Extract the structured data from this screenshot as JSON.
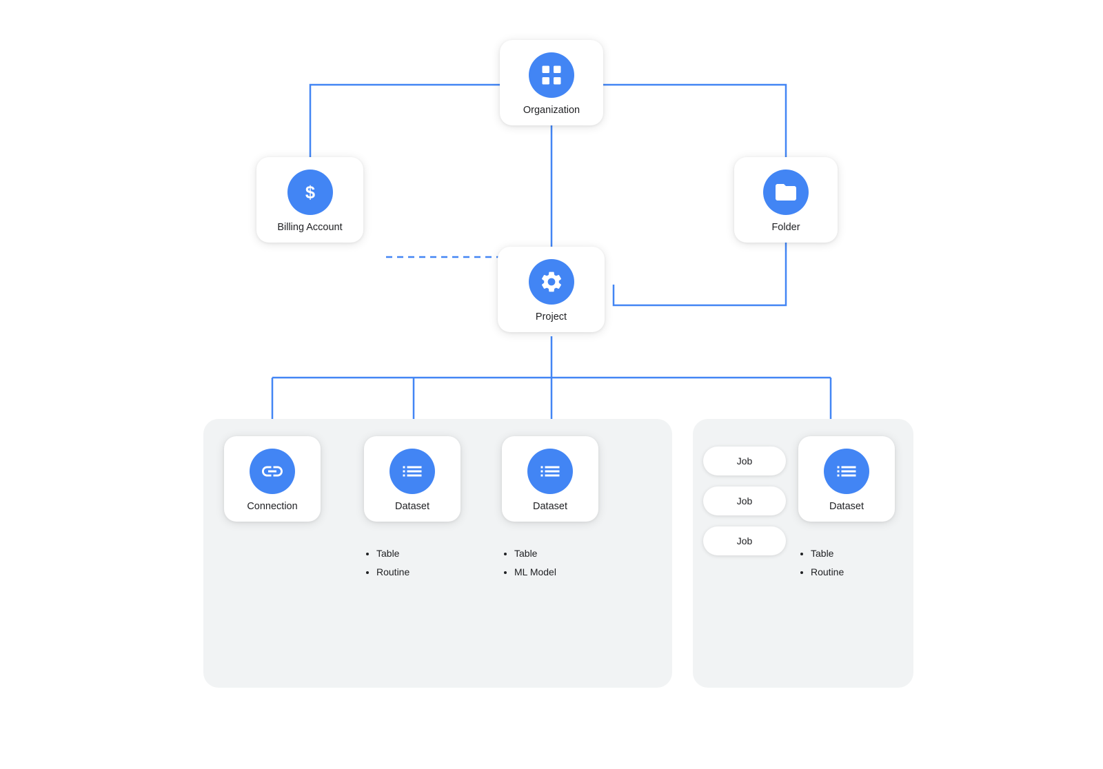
{
  "nodes": {
    "organization": {
      "label": "Organization"
    },
    "billing": {
      "label": "Billing Account"
    },
    "folder": {
      "label": "Folder"
    },
    "project": {
      "label": "Project"
    },
    "connection": {
      "label": "Connection"
    },
    "dataset1": {
      "label": "Dataset",
      "bullets": [
        "Table",
        "Routine"
      ]
    },
    "dataset2": {
      "label": "Dataset",
      "bullets": [
        "Table",
        "ML Model"
      ]
    },
    "dataset3": {
      "label": "Dataset",
      "bullets": [
        "Table",
        "Routine"
      ]
    },
    "job1": {
      "label": "Job"
    },
    "job2": {
      "label": "Job"
    },
    "job3": {
      "label": "Job"
    }
  }
}
